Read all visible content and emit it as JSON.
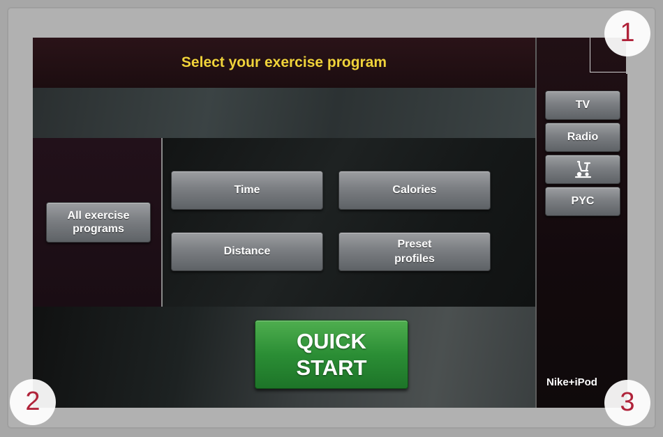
{
  "header": {
    "title": "Select your exercise program"
  },
  "left": {
    "all_programs_line1": "All exercise",
    "all_programs_line2": "programs"
  },
  "programs": {
    "time": "Time",
    "calories": "Calories",
    "distance": "Distance",
    "preset_line1": "Preset",
    "preset_line2": "profiles"
  },
  "quick_start": {
    "line1": "QUICK",
    "line2": "START"
  },
  "sidebar": {
    "tv": "TV",
    "radio": "Radio",
    "bike_icon": "exercise-bike-icon",
    "pyc": "PYC",
    "nike": "Nike+iPod"
  },
  "callouts": {
    "one": "1",
    "two": "2",
    "three": "3"
  },
  "colors": {
    "title": "#f0d33a",
    "quick_start": "#2b8e35",
    "callout_text": "#b0233a"
  }
}
